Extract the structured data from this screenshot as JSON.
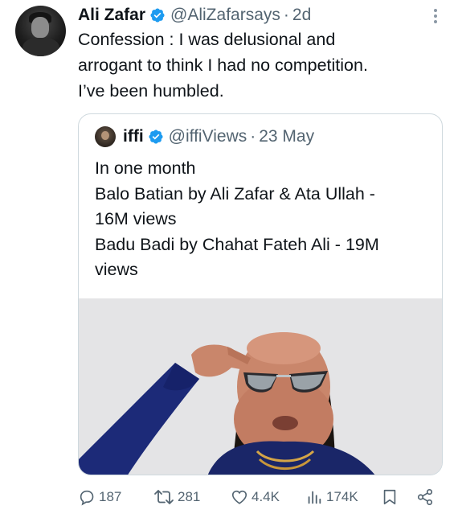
{
  "author": {
    "name": "Ali Zafar",
    "handle": "@AliZafarsays",
    "separator": "·",
    "time": "2d"
  },
  "tweet": {
    "lines": [
      "Confession : I was delusional and",
      "arrogant to think I had no competition.",
      "I’ve been humbled."
    ]
  },
  "quoted": {
    "name": "iffi",
    "handle": "@iffiViews",
    "separator": "·",
    "time": "23 May",
    "lines": [
      "In one month",
      "Balo Batian by Ali Zafar & Ata Ullah -",
      "16M views",
      "Badu Badi by Chahat Fateh Ali - 19M",
      "views"
    ],
    "media_description": "photo-of-man-in-sunglasses"
  },
  "actions": {
    "replies": "187",
    "retweets": "281",
    "likes": "4.4K",
    "views": "174K"
  },
  "colors": {
    "text": "#0f1419",
    "secondary": "#536471",
    "verified": "#1d9bf0",
    "border": "#cfd9de"
  },
  "icons": [
    "verified-badge-icon",
    "more-options-icon",
    "reply-icon",
    "retweet-icon",
    "like-icon",
    "views-icon",
    "bookmark-icon",
    "share-icon"
  ]
}
